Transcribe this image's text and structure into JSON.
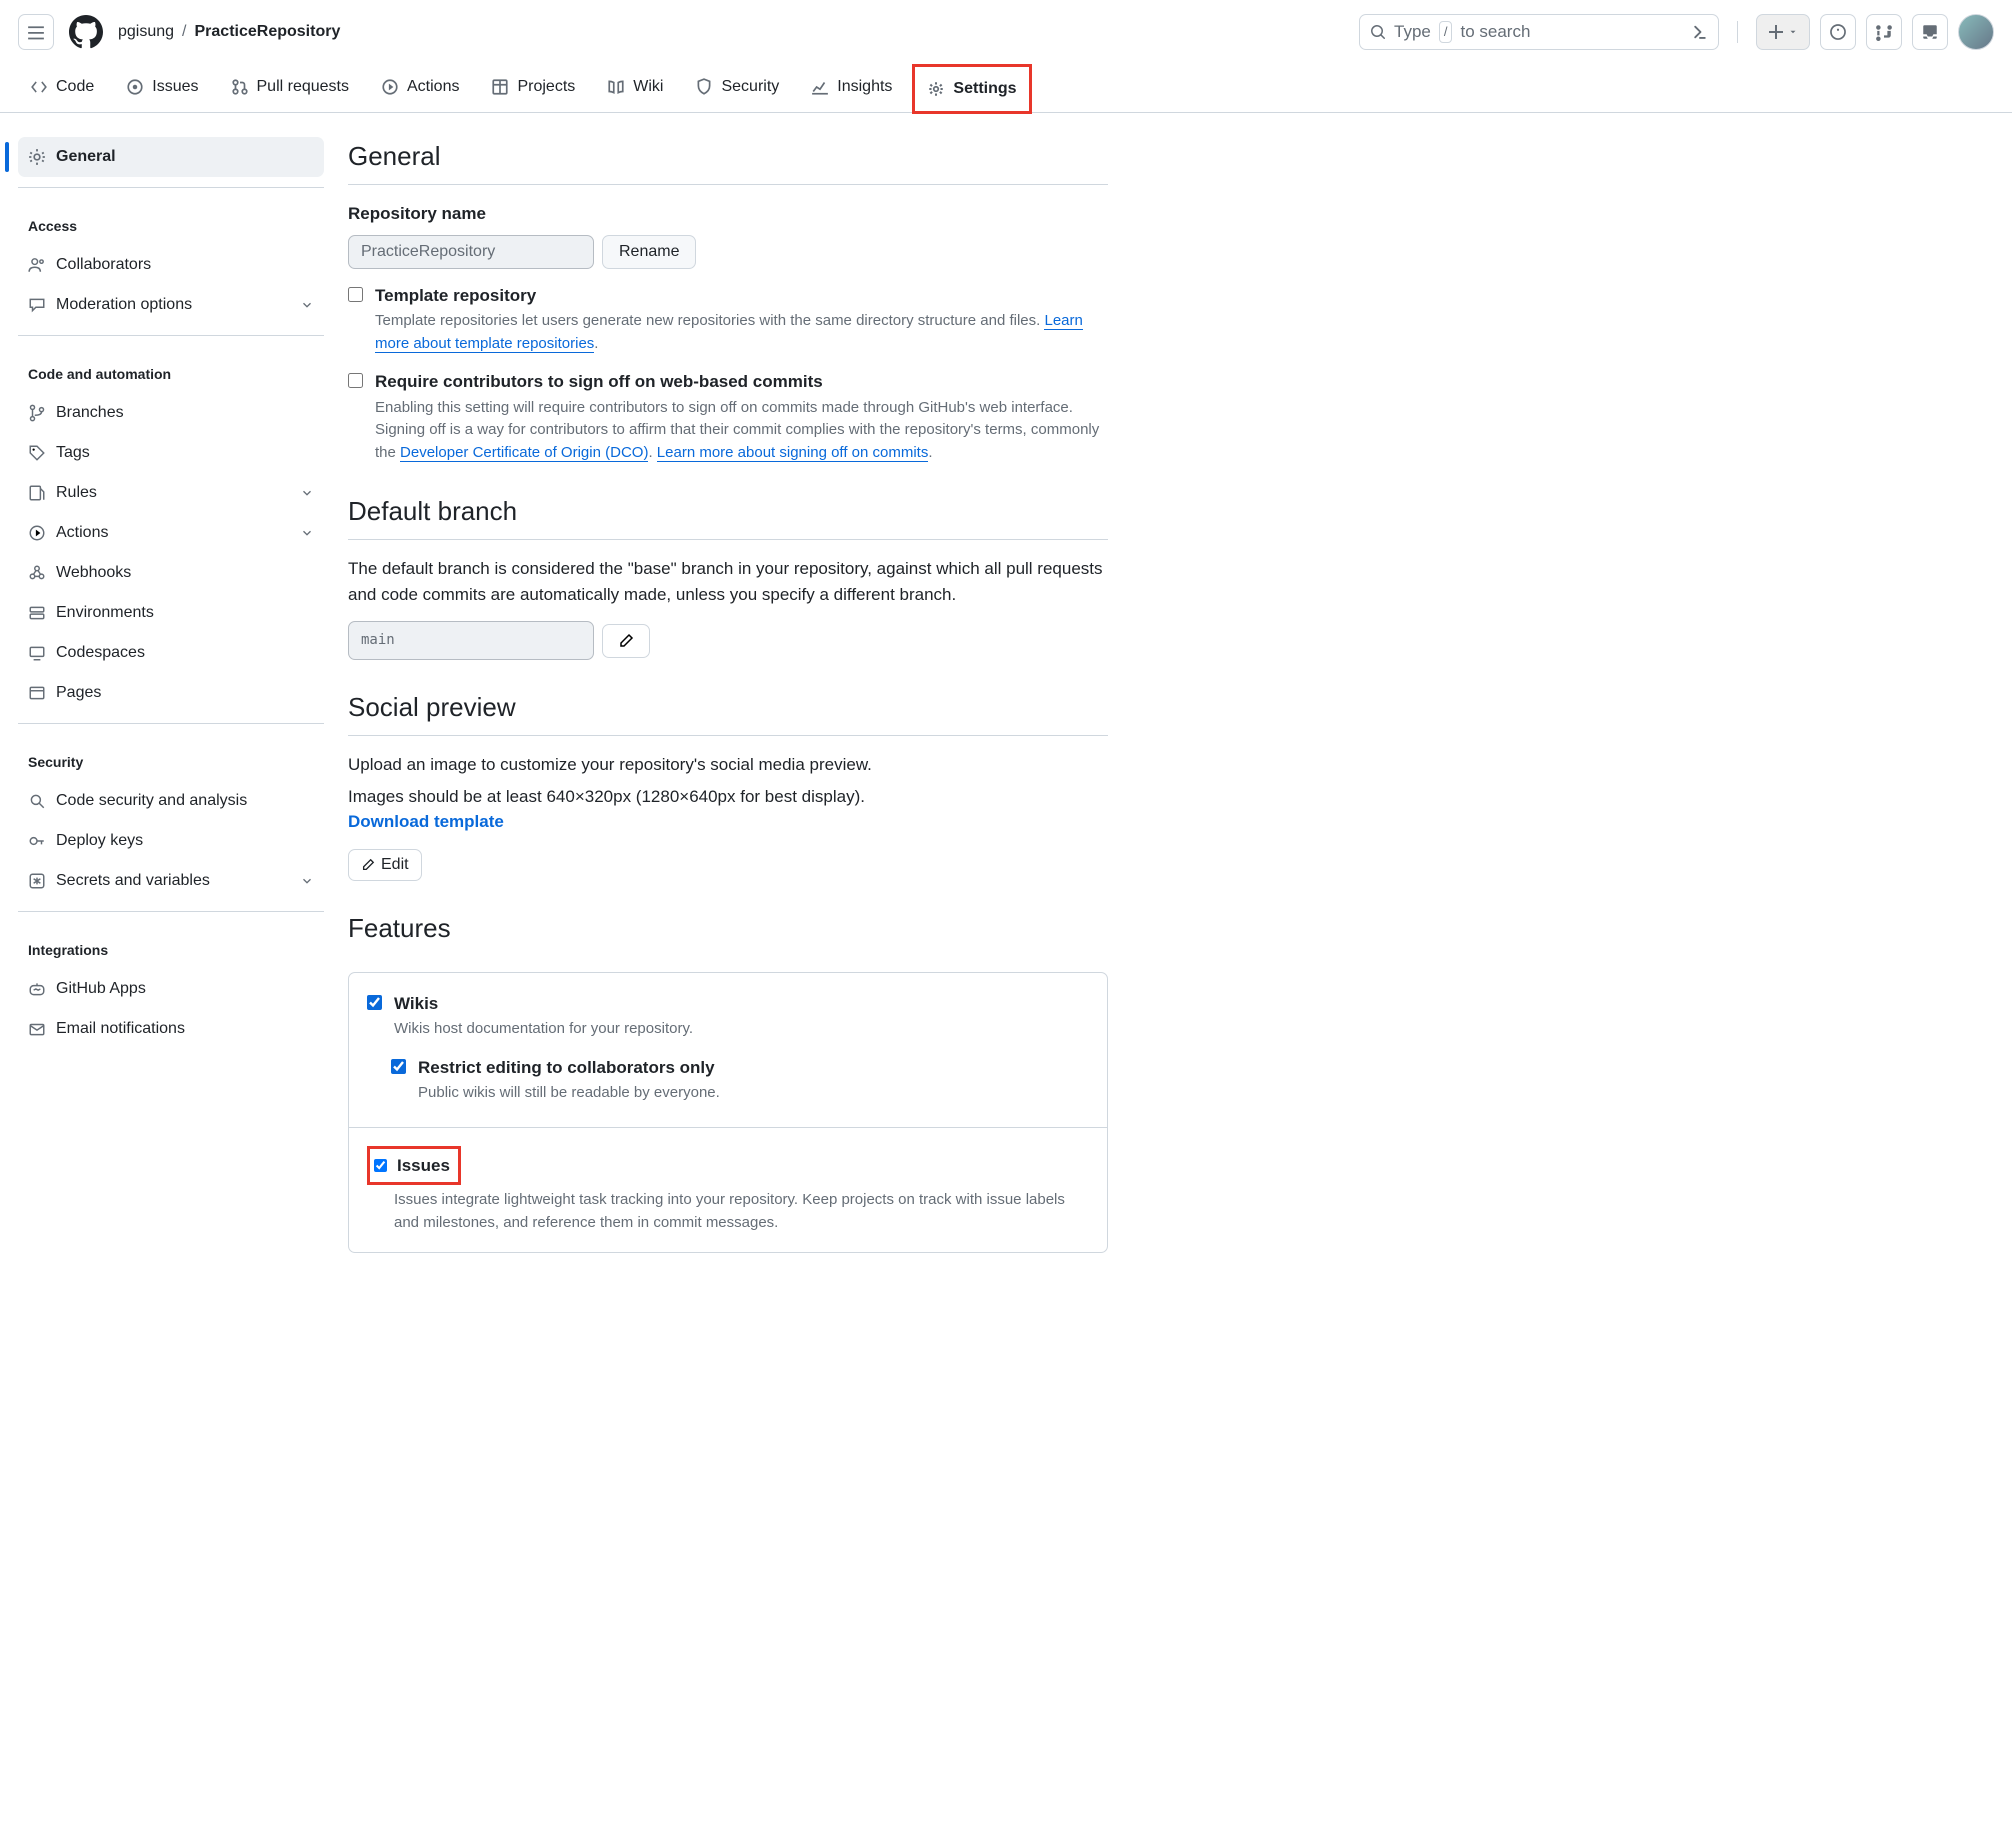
{
  "header": {
    "owner": "pgisung",
    "repo": "PracticeRepository",
    "search_type": "Type",
    "search_slash": "/",
    "search_to": "to search"
  },
  "tabs": [
    {
      "id": "code",
      "label": "Code"
    },
    {
      "id": "issues",
      "label": "Issues"
    },
    {
      "id": "pulls",
      "label": "Pull requests"
    },
    {
      "id": "actions",
      "label": "Actions"
    },
    {
      "id": "projects",
      "label": "Projects"
    },
    {
      "id": "wiki",
      "label": "Wiki"
    },
    {
      "id": "security",
      "label": "Security"
    },
    {
      "id": "insights",
      "label": "Insights"
    },
    {
      "id": "settings",
      "label": "Settings"
    }
  ],
  "sidebar": {
    "general": "General",
    "access_title": "Access",
    "collaborators": "Collaborators",
    "moderation": "Moderation options",
    "code_title": "Code and automation",
    "branches": "Branches",
    "tags": "Tags",
    "rules": "Rules",
    "actions": "Actions",
    "webhooks": "Webhooks",
    "environments": "Environments",
    "codespaces": "Codespaces",
    "pages": "Pages",
    "security_title": "Security",
    "codesec": "Code security and analysis",
    "deploykeys": "Deploy keys",
    "secrets": "Secrets and variables",
    "integrations_title": "Integrations",
    "ghapps": "GitHub Apps",
    "emailnotif": "Email notifications"
  },
  "main": {
    "general_h": "General",
    "repo_name_label": "Repository name",
    "repo_name_value": "PracticeRepository",
    "rename_btn": "Rename",
    "template_title": "Template repository",
    "template_desc_a": "Template repositories let users generate new repositories with the same directory structure and files. ",
    "template_link": "Learn more about template repositories",
    "signoff_title": "Require contributors to sign off on web-based commits",
    "signoff_desc_a": "Enabling this setting will require contributors to sign off on commits made through GitHub's web interface. Signing off is a way for contributors to affirm that their commit complies with the repository's terms, commonly the ",
    "signoff_link1": "Developer Certificate of Origin (DCO)",
    "signoff_mid": ". ",
    "signoff_link2": "Learn more about signing off on commits",
    "default_branch_h": "Default branch",
    "default_branch_desc": "The default branch is considered the \"base\" branch in your repository, against which all pull requests and code commits are automatically made, unless you specify a different branch.",
    "default_branch_value": "main",
    "social_h": "Social preview",
    "social_desc1": "Upload an image to customize your repository's social media preview.",
    "social_desc2": "Images should be at least 640×320px (1280×640px for best display).",
    "download_template": "Download template",
    "edit_btn": "Edit",
    "features_h": "Features",
    "wikis_title": "Wikis",
    "wikis_desc": "Wikis host documentation for your repository.",
    "restrict_title": "Restrict editing to collaborators only",
    "restrict_desc": "Public wikis will still be readable by everyone.",
    "issues_title": "Issues",
    "issues_desc": "Issues integrate lightweight task tracking into your repository. Keep projects on track with issue labels and milestones, and reference them in commit messages."
  }
}
